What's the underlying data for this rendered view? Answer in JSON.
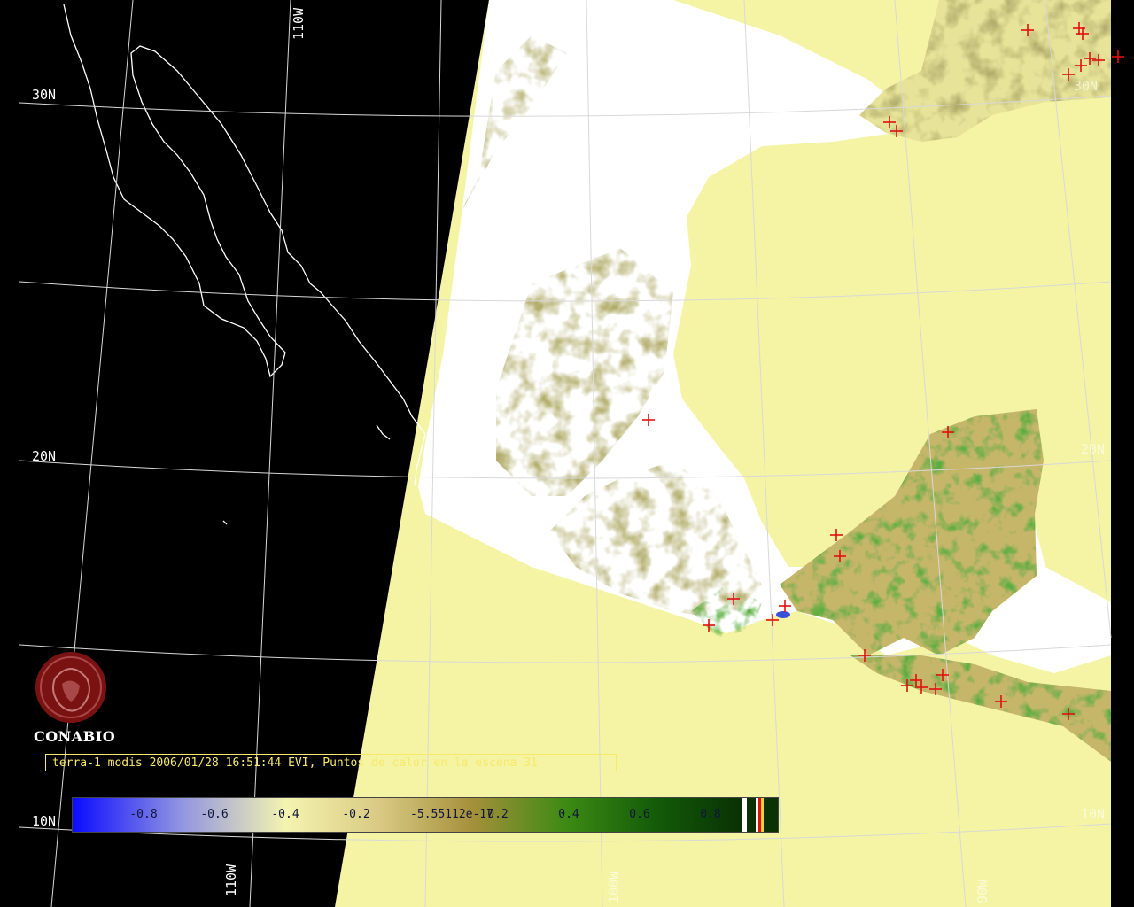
{
  "caption": "terra-1 modis 2006/01/28 16:51:44 EVI, Puntos de calor en la escena 31",
  "logo": {
    "name": "CONABIO",
    "icon": "conabio-logo-icon"
  },
  "graticule": {
    "lat_labels": [
      "30N",
      "20N",
      "10N",
      "30N",
      "20N",
      "10N"
    ],
    "lon_labels": [
      "110W",
      "110W",
      "100W",
      "100W",
      "90W"
    ]
  },
  "colorbar": {
    "ticks": [
      "-0.8",
      "-0.6",
      "-0.4",
      "-0.2",
      "-5.55112e-17",
      "0.2",
      "0.4",
      "0.6",
      "0.8"
    ],
    "colors": {
      "blue": "#1010ff",
      "pale": "#f4f4a8",
      "tan": "#b9a24e",
      "green": "#2f8a12",
      "dark_green": "#0c3d05",
      "fire_red": "#e01010",
      "caption_yellow": "#f7e96b"
    }
  }
}
